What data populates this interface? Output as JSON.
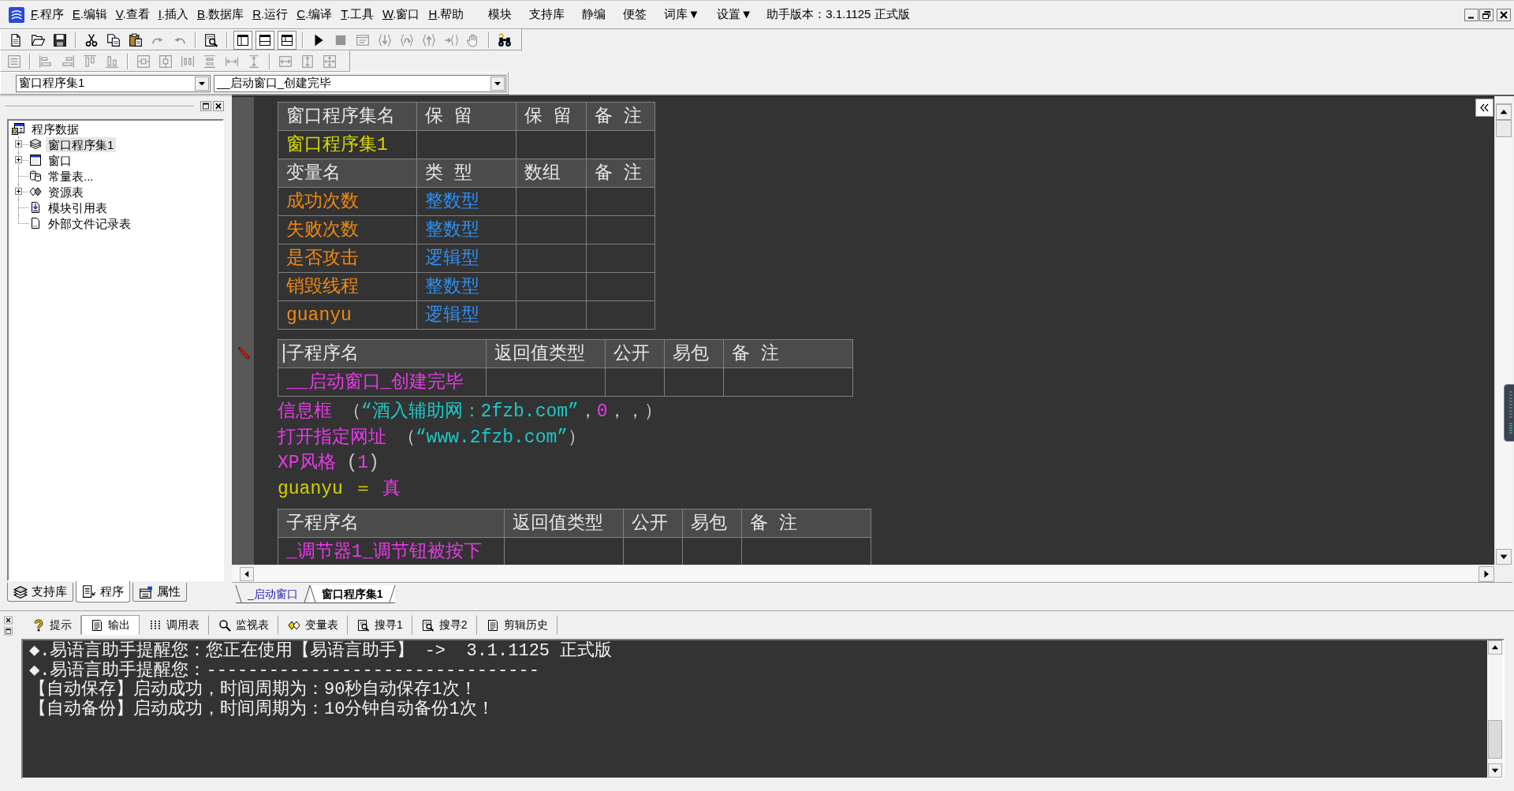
{
  "menu_bar": {
    "menus": [
      "F.程序",
      "E.编辑",
      "V.查看",
      "I.插入",
      "B.数据库",
      "R.运行",
      "C.编译",
      "T.工具",
      "W.窗口",
      "H.帮助"
    ],
    "addons": [
      "模块",
      "支持库",
      "静编",
      "便签",
      "词库▼",
      "设置▼"
    ],
    "version": "助手版本：3.1.1125 正式版"
  },
  "toolbars": [
    {
      "groups": [
        {
          "kind": "buttons",
          "items": [
            {
              "kind": "new",
              "disabled": false
            },
            {
              "kind": "open",
              "disabled": false
            },
            {
              "kind": "save",
              "disabled": false
            }
          ]
        },
        {
          "kind": "buttons",
          "items": [
            {
              "kind": "cut",
              "disabled": false
            },
            {
              "kind": "copy",
              "disabled": false
            },
            {
              "kind": "paste",
              "disabled": false
            },
            {
              "kind": "redo",
              "disabled": true
            },
            {
              "kind": "undo",
              "disabled": true
            }
          ]
        },
        {
          "kind": "buttons",
          "items": [
            {
              "kind": "find",
              "disabled": false
            }
          ]
        },
        {
          "kind": "toggles",
          "items": [
            {
              "kind": "leftpane",
              "checked": true
            },
            {
              "kind": "bottompane",
              "checked": true
            },
            {
              "kind": "bothpanes",
              "checked": true
            }
          ]
        },
        {
          "kind": "buttons",
          "items": [
            {
              "kind": "run",
              "disabled": false
            },
            {
              "kind": "stop",
              "disabled": true
            },
            {
              "kind": "debug",
              "disabled": true
            },
            {
              "kind": "stepinto",
              "disabled": true
            },
            {
              "kind": "stepover",
              "disabled": true
            },
            {
              "kind": "stepout",
              "disabled": true
            },
            {
              "kind": "runto",
              "disabled": true
            },
            {
              "kind": "hand",
              "disabled": true
            }
          ]
        },
        {
          "kind": "buttons",
          "items": [
            {
              "kind": "binoculars",
              "disabled": false
            }
          ]
        }
      ]
    },
    {
      "groups": [
        {
          "kind": "buttons",
          "items": [
            {
              "kind": "grid",
              "disabled": true
            }
          ]
        },
        {
          "kind": "buttons",
          "items": [
            {
              "kind": "alignleft",
              "disabled": true
            },
            {
              "kind": "alignright",
              "disabled": true
            },
            {
              "kind": "aligntop",
              "disabled": true
            },
            {
              "kind": "alignbottom",
              "disabled": true
            }
          ]
        },
        {
          "kind": "buttons",
          "items": [
            {
              "kind": "centerh",
              "disabled": true
            },
            {
              "kind": "centerv",
              "disabled": true
            },
            {
              "kind": "spaceh",
              "disabled": true
            },
            {
              "kind": "spacev",
              "disabled": true
            },
            {
              "kind": "spreadh",
              "disabled": true
            },
            {
              "kind": "spreadv",
              "disabled": true
            }
          ]
        },
        {
          "kind": "buttons",
          "items": [
            {
              "kind": "samewidth",
              "disabled": true
            },
            {
              "kind": "sameheight",
              "disabled": true
            },
            {
              "kind": "samesize",
              "disabled": true
            }
          ]
        }
      ]
    }
  ],
  "selectors": [
    {
      "value": "窗口程序集1"
    },
    {
      "value": "__启动窗口_创建完毕"
    }
  ],
  "tree_panel": {
    "tree": [
      {
        "label": "程序数据",
        "kind": "program",
        "selected": false,
        "children": [
          {
            "label": "窗口程序集1",
            "kind": "classes",
            "expanded": false,
            "selected": true
          },
          {
            "label": "窗口",
            "kind": "window",
            "expanded": false,
            "selected": false
          },
          {
            "label": "常量表...",
            "kind": "constants",
            "selected": false
          },
          {
            "label": "资源表",
            "kind": "resources",
            "expanded": false,
            "selected": false
          },
          {
            "label": "模块引用表",
            "kind": "modules",
            "selected": false
          },
          {
            "label": "外部文件记录表",
            "kind": "files",
            "selected": false
          }
        ]
      }
    ],
    "tabs": [
      {
        "label": "支持库",
        "kind": "library",
        "selected": false
      },
      {
        "label": "程序",
        "kind": "program",
        "selected": true
      },
      {
        "label": "属性",
        "kind": "properties",
        "selected": false
      }
    ]
  },
  "editor": {
    "class_table": {
      "columns": [
        "窗口程序集名",
        "保 留",
        "保 留",
        "备 注"
      ],
      "rows": [
        {
          "name": "窗口程序集1"
        }
      ]
    },
    "variable_table": {
      "columns": [
        "变量名",
        "类 型",
        "数组",
        "备 注"
      ],
      "rows": [
        {
          "name": "成功次数",
          "type": "整数型"
        },
        {
          "name": "失败次数",
          "type": "整数型"
        },
        {
          "name": "是否攻击",
          "type": "逻辑型"
        },
        {
          "name": "销毁线程",
          "type": "整数型"
        },
        {
          "name": "guanyu",
          "type": "逻辑型"
        }
      ]
    },
    "subroutines": [
      {
        "columns": [
          "子程序名",
          "返回值类型",
          "公开",
          "易包",
          "备 注"
        ],
        "name": "__启动窗口_创建完毕",
        "focused": true,
        "code": [
          {
            "tokens": [
              {
                "kind": "command",
                "text": "信息框"
              },
              {
                "kind": "punct",
                "text": " （"
              },
              {
                "kind": "string",
                "text": "“酒入辅助网：2fzb.com”"
              },
              {
                "kind": "punct",
                "text": "，"
              },
              {
                "kind": "number",
                "text": "0"
              },
              {
                "kind": "punct",
                "text": "，，）"
              }
            ]
          },
          {
            "tokens": [
              {
                "kind": "command",
                "text": "打开指定网址"
              },
              {
                "kind": "punct",
                "text": " （"
              },
              {
                "kind": "string",
                "text": "“www.2fzb.com”"
              },
              {
                "kind": "punct",
                "text": "）"
              }
            ]
          },
          {
            "tokens": [
              {
                "kind": "command",
                "text": "XP风格"
              },
              {
                "kind": "punct",
                "text": " ("
              },
              {
                "kind": "number",
                "text": "1"
              },
              {
                "kind": "punct",
                "text": ")"
              }
            ]
          },
          {
            "tokens": [
              {
                "kind": "variable",
                "text": "guanyu"
              },
              {
                "kind": "operator",
                "text": " ＝ "
              },
              {
                "kind": "constant",
                "text": "真"
              }
            ]
          }
        ]
      },
      {
        "columns": [
          "子程序名",
          "返回值类型",
          "公开",
          "易包",
          "备 注"
        ],
        "name": "_调节器1_调节钮被按下",
        "focused": false
      }
    ],
    "tabs": [
      {
        "label": "_启动窗口",
        "selected": false
      },
      {
        "label": "窗口程序集1",
        "selected": true
      }
    ]
  },
  "output_panel": {
    "tabs": [
      {
        "label": "提示",
        "kind": "hint",
        "selected": false
      },
      {
        "label": "输出",
        "kind": "output",
        "selected": true
      },
      {
        "label": "调用表",
        "kind": "calls",
        "selected": false
      },
      {
        "label": "监视表",
        "kind": "watch",
        "selected": false
      },
      {
        "label": "变量表",
        "kind": "variables",
        "selected": false
      },
      {
        "label": "搜寻1",
        "kind": "search",
        "selected": false
      },
      {
        "label": "搜寻2",
        "kind": "search",
        "selected": false
      },
      {
        "label": "剪辑历史",
        "kind": "clips",
        "selected": false
      }
    ],
    "lines": [
      "◆.易语言助手提醒您：您正在使用【易语言助手】 ->  3.1.1125 正式版",
      "◆.易语言助手提醒您：--------------------------------",
      "【自动保存】启动成功，时间周期为：90秒自动保存1次！",
      "【自动备份】启动成功，时间周期为：10分钟自动备份1次！"
    ]
  }
}
